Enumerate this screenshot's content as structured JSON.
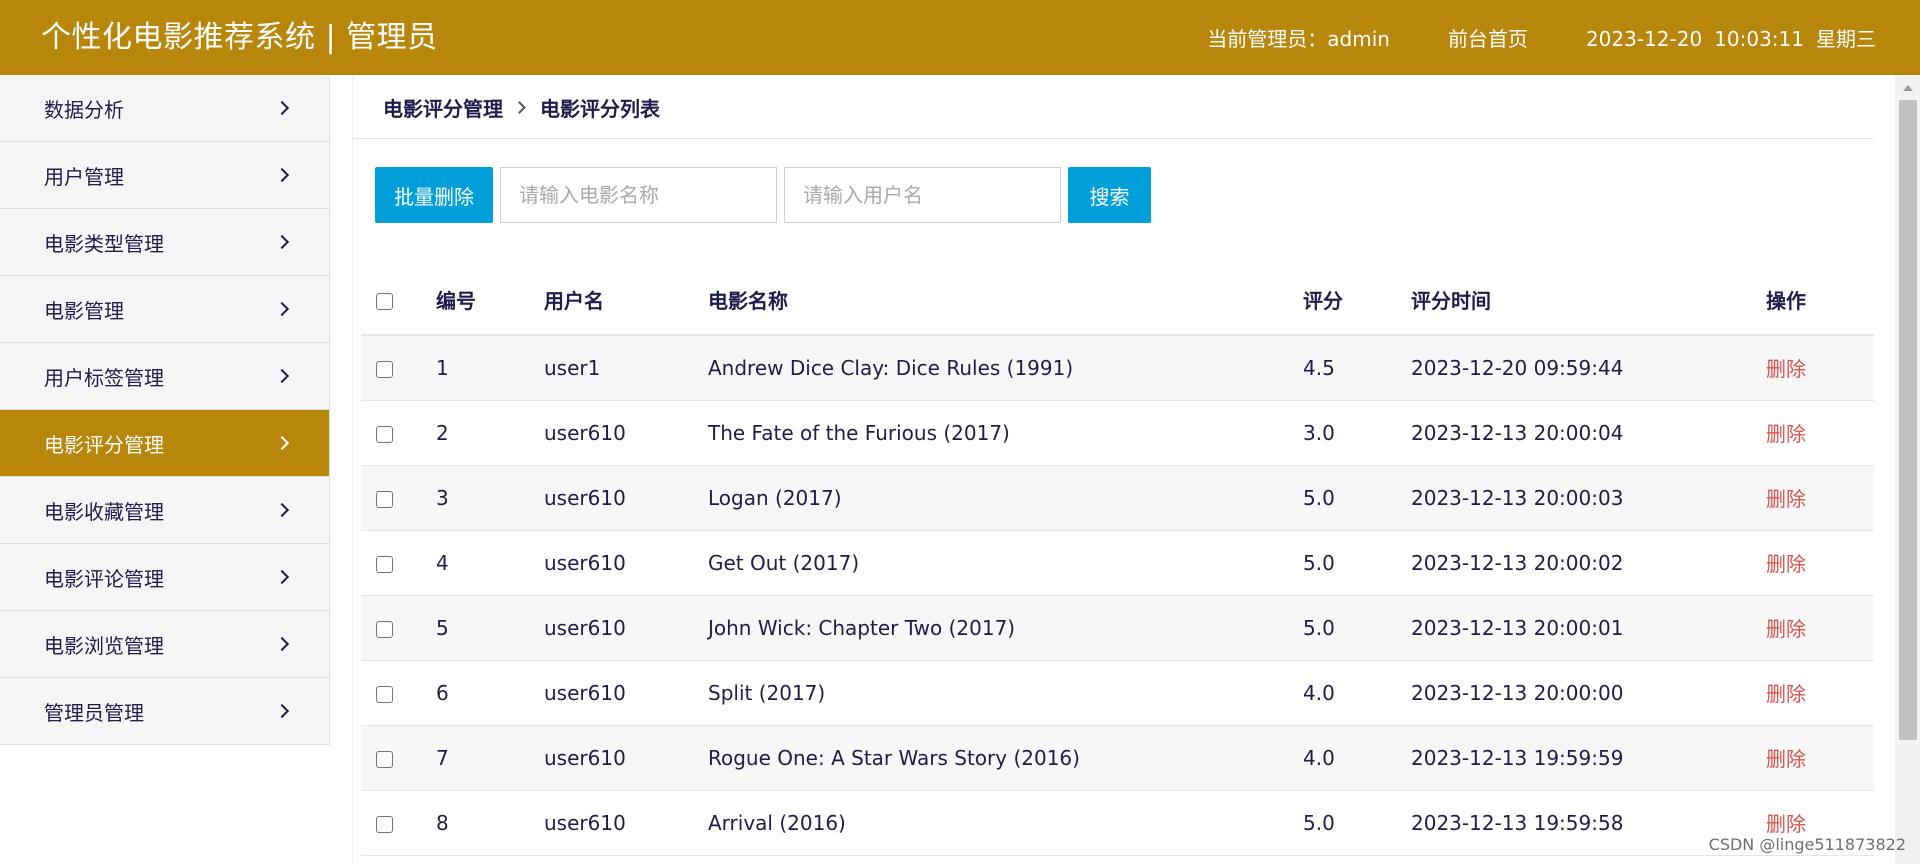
{
  "header": {
    "title": "个性化电影推荐系统 | 管理员",
    "admin_label": "当前管理员：admin",
    "front_link": "前台首页",
    "date": "2023-12-20",
    "time": "10:03:11",
    "weekday": "星期三"
  },
  "sidebar": {
    "items": [
      {
        "label": "数据分析"
      },
      {
        "label": "用户管理"
      },
      {
        "label": "电影类型管理"
      },
      {
        "label": "电影管理"
      },
      {
        "label": "用户标签管理"
      },
      {
        "label": "电影评分管理"
      },
      {
        "label": "电影收藏管理"
      },
      {
        "label": "电影评论管理"
      },
      {
        "label": "电影浏览管理"
      },
      {
        "label": "管理员管理"
      }
    ],
    "active_index": 5
  },
  "breadcrumb": {
    "parent": "电影评分管理",
    "current": "电影评分列表"
  },
  "toolbar": {
    "batch_delete": "批量删除",
    "movie_placeholder": "请输入电影名称",
    "user_placeholder": "请输入用户名",
    "search": "搜索"
  },
  "table": {
    "columns": [
      "编号",
      "用户名",
      "电影名称",
      "评分",
      "评分时间",
      "操作"
    ],
    "rows": [
      {
        "id": "1",
        "user": "user1",
        "movie": "Andrew Dice Clay: Dice Rules (1991)",
        "score": "4.5",
        "time": "2023-12-20 09:59:44",
        "action": "删除"
      },
      {
        "id": "2",
        "user": "user610",
        "movie": "The Fate of the Furious (2017)",
        "score": "3.0",
        "time": "2023-12-13 20:00:04",
        "action": "删除"
      },
      {
        "id": "3",
        "user": "user610",
        "movie": "Logan (2017)",
        "score": "5.0",
        "time": "2023-12-13 20:00:03",
        "action": "删除"
      },
      {
        "id": "4",
        "user": "user610",
        "movie": "Get Out (2017)",
        "score": "5.0",
        "time": "2023-12-13 20:00:02",
        "action": "删除"
      },
      {
        "id": "5",
        "user": "user610",
        "movie": "John Wick: Chapter Two (2017)",
        "score": "5.0",
        "time": "2023-12-13 20:00:01",
        "action": "删除"
      },
      {
        "id": "6",
        "user": "user610",
        "movie": "Split (2017)",
        "score": "4.0",
        "time": "2023-12-13 20:00:00",
        "action": "删除"
      },
      {
        "id": "7",
        "user": "user610",
        "movie": "Rogue One: A Star Wars Story (2016)",
        "score": "4.0",
        "time": "2023-12-13 19:59:59",
        "action": "删除"
      },
      {
        "id": "8",
        "user": "user610",
        "movie": "Arrival (2016)",
        "score": "5.0",
        "time": "2023-12-13 19:59:58",
        "action": "删除"
      }
    ]
  },
  "watermark": "CSDN @linge511873822",
  "colors": {
    "brand": "#b8860b",
    "primary_button": "#009fd9",
    "delete_link": "#d9534f",
    "text": "#1f1d4d"
  },
  "icons": {
    "sidebar_chevron": "chevron-right-icon",
    "breadcrumb_separator": "chevron-right-icon"
  }
}
